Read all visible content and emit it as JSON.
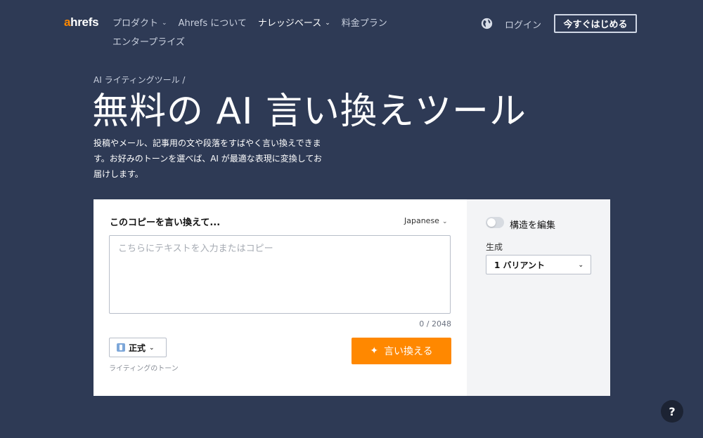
{
  "header": {
    "logo_a": "a",
    "logo_rest": "hrefs",
    "nav": [
      {
        "label": "プロダクト",
        "chevron": true,
        "active": false
      },
      {
        "label": "Ahrefs について",
        "chevron": false,
        "active": false
      },
      {
        "label": "ナレッジベース",
        "chevron": true,
        "active": true
      },
      {
        "label": "料金プラン",
        "chevron": false,
        "active": false
      },
      {
        "label": "エンタープライズ",
        "chevron": false,
        "active": false
      }
    ],
    "globe_icon": "globe-icon",
    "login_label": "ログイン",
    "start_label": "今すぐはじめる"
  },
  "hero": {
    "breadcrumb": "AI ライティングツール /",
    "title": "無料の AI 言い換えツール",
    "description": "投稿やメール、記事用の文や段落をすばやく言い換えできます。お好みのトーンを選べば、AI が最適な表現に変換してお届けします。"
  },
  "tool": {
    "title": "このコピーを言い換えて...",
    "language": "Japanese",
    "placeholder": "こちらにテキストを入力またはコピー",
    "counter": "0 / 2048",
    "tone_value": "正式",
    "tone_label": "ライティングのトーン",
    "rewrite_label": "言い換える",
    "toggle_label": "構造を編集",
    "generate_label": "生成",
    "variant_value": "1 バリアント"
  },
  "help_label": "?",
  "colors": {
    "background": "#2e3a55",
    "accent": "#ff8800",
    "panel": "#f3f4f6"
  }
}
